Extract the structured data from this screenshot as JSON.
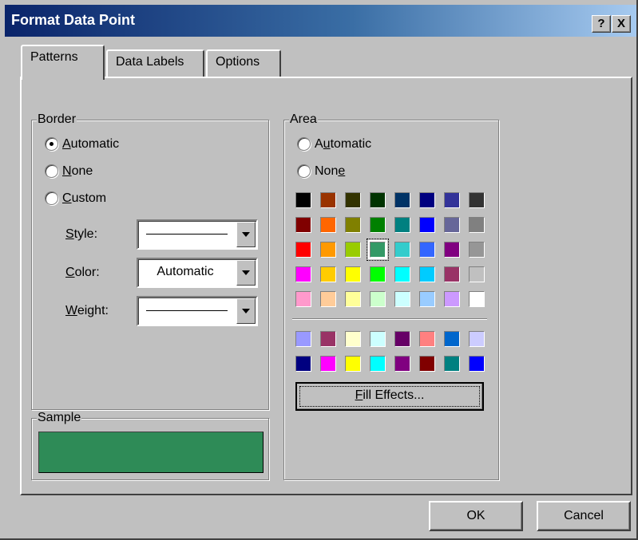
{
  "window": {
    "title": "Format Data Point",
    "help_button": "?",
    "close_button": "X"
  },
  "tabs": [
    {
      "label": "Patterns",
      "active": true
    },
    {
      "label": "Data Labels",
      "active": false
    },
    {
      "label": "Options",
      "active": false
    }
  ],
  "border": {
    "legend": "Border",
    "options": [
      {
        "pre": "",
        "key": "A",
        "post": "utomatic",
        "checked": true
      },
      {
        "pre": "",
        "key": "N",
        "post": "one",
        "checked": false
      },
      {
        "pre": "",
        "key": "C",
        "post": "ustom",
        "checked": false
      }
    ],
    "style_label": {
      "pre": "",
      "key": "S",
      "post": "tyle:"
    },
    "color_label": {
      "pre": "",
      "key": "C",
      "post": "olor:"
    },
    "weight_label": {
      "pre": "",
      "key": "W",
      "post": "eight:"
    },
    "color_value": "Automatic"
  },
  "sample": {
    "legend": "Sample",
    "color": "#2e8b57"
  },
  "area": {
    "legend": "Area",
    "options": [
      {
        "pre": "A",
        "key": "u",
        "post": "tomatic",
        "checked": false
      },
      {
        "pre": "Non",
        "key": "e",
        "post": "",
        "checked": false
      }
    ],
    "palette": [
      [
        "#000000",
        "#993300",
        "#333300",
        "#003300",
        "#003366",
        "#000080",
        "#333399",
        "#333333"
      ],
      [
        "#800000",
        "#ff6600",
        "#808000",
        "#008000",
        "#008080",
        "#0000ff",
        "#666699",
        "#808080"
      ],
      [
        "#ff0000",
        "#ff9900",
        "#99cc00",
        "#339966",
        "#33cccc",
        "#3366ff",
        "#800080",
        "#969696"
      ],
      [
        "#ff00ff",
        "#ffcc00",
        "#ffff00",
        "#00ff00",
        "#00ffff",
        "#00ccff",
        "#993366",
        "#c0c0c0"
      ],
      [
        "#ff99cc",
        "#ffcc99",
        "#ffff99",
        "#ccffcc",
        "#ccffff",
        "#99ccff",
        "#cc99ff",
        "#ffffff"
      ]
    ],
    "extra_palette": [
      [
        "#9999ff",
        "#993366",
        "#ffffcc",
        "#ccffff",
        "#660066",
        "#ff8080",
        "#0066cc",
        "#ccccff"
      ],
      [
        "#000080",
        "#ff00ff",
        "#ffff00",
        "#00ffff",
        "#800080",
        "#800000",
        "#008080",
        "#0000ff"
      ]
    ],
    "selected_swatch": "#339966",
    "fill_effects": {
      "pre": "",
      "key": "F",
      "post": "ill Effects..."
    }
  },
  "buttons": {
    "ok": "OK",
    "cancel": "Cancel"
  }
}
